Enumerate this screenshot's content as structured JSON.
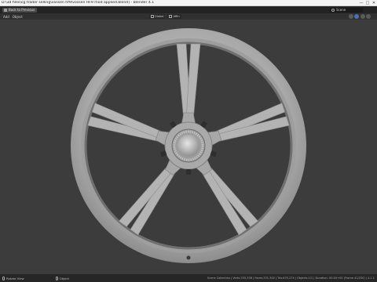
{
  "window": {
    "title": "D:\\3d files\\cg trader selling\\vossen hf9\\vossen HF9 mod applied.blend] - Blender 4.1",
    "controls": [
      "—",
      "□",
      "✕"
    ]
  },
  "topbar": {
    "back_label": "Back to Previous",
    "scene_label": "Scene"
  },
  "header": {
    "menus": [
      "Add",
      "Object"
    ]
  },
  "viewport_header": {
    "transform_label": "Global",
    "snap_label": "Affin"
  },
  "statusbar": {
    "left_items": [
      "Rotate View",
      "Object"
    ],
    "stats": "Scene Collection | Verts:335,336 | Faces:331,300 | Tris:670,274 | Objects:1/1 | Duration: 00:00+00 (Frame 41/250) | 4.1.1"
  },
  "colors": {
    "background": "#3c3c3c",
    "wheel": "#b9b9b9",
    "accent": "#4772b3"
  }
}
